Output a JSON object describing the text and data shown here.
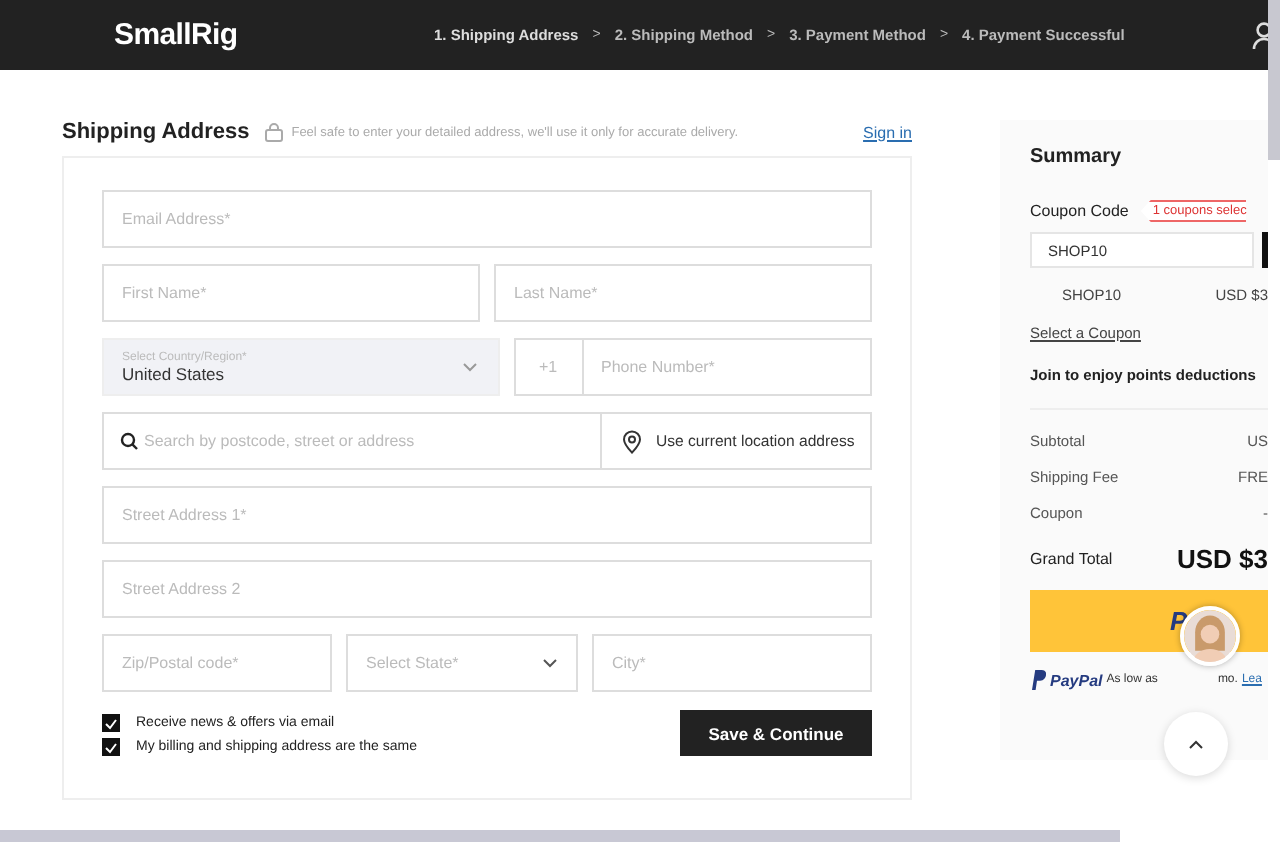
{
  "header": {
    "logo": "SmallRig",
    "steps": [
      {
        "label": "1. Shipping Address",
        "selected": true
      },
      {
        "label": "2. Shipping Method",
        "selected": false
      },
      {
        "label": "3. Payment Method",
        "selected": false
      },
      {
        "label": "4. Payment Successful",
        "selected": false
      }
    ],
    "separator": ">"
  },
  "shipping": {
    "title": "Shipping Address",
    "note": "Feel safe to enter your detailed address, we'll use it only for accurate delivery.",
    "sign_in": "Sign in",
    "email": {
      "placeholder": "Email Address*"
    },
    "first_name": {
      "placeholder": "First Name*"
    },
    "last_name": {
      "placeholder": "Last Name*"
    },
    "country": {
      "label": "Select Country/Region*",
      "value": "United States"
    },
    "phone_code": "+1",
    "phone": {
      "placeholder": "Phone Number*"
    },
    "search": {
      "placeholder": "Search by postcode, street or address"
    },
    "location_button": "Use current location address",
    "street1": {
      "placeholder": "Street Address 1*"
    },
    "street2": {
      "placeholder": "Street Address 2"
    },
    "zip": {
      "placeholder": "Zip/Postal code*"
    },
    "state": {
      "placeholder": "Select State*"
    },
    "city": {
      "placeholder": "City*"
    },
    "checkboxes": [
      {
        "label": "Receive news & offers via email",
        "checked": true
      },
      {
        "label": "My billing and shipping address are the same",
        "checked": true
      }
    ],
    "save_button": "Save & Continue"
  },
  "summary": {
    "title": "Summary",
    "coupon_label": "Coupon Code",
    "coupon_badge": "1 coupons selec",
    "coupon_input": "SHOP10",
    "applied_code": "SHOP10",
    "applied_value": "USD $3",
    "select_coupon": "Select a Coupon",
    "points": "Join to enjoy points deductions",
    "lines": [
      {
        "label": "Subtotal",
        "value": "US"
      },
      {
        "label": "Shipping Fee",
        "value": "FRE"
      },
      {
        "label": "Coupon",
        "value": "-"
      }
    ],
    "grand_total_label": "Grand Total",
    "grand_total": "USD $3",
    "paypal_button": "P",
    "paypal_brand": "PayPal",
    "paypal_note": "As low as",
    "paypal_note_end": "mo.",
    "paypal_link": "Lea"
  }
}
